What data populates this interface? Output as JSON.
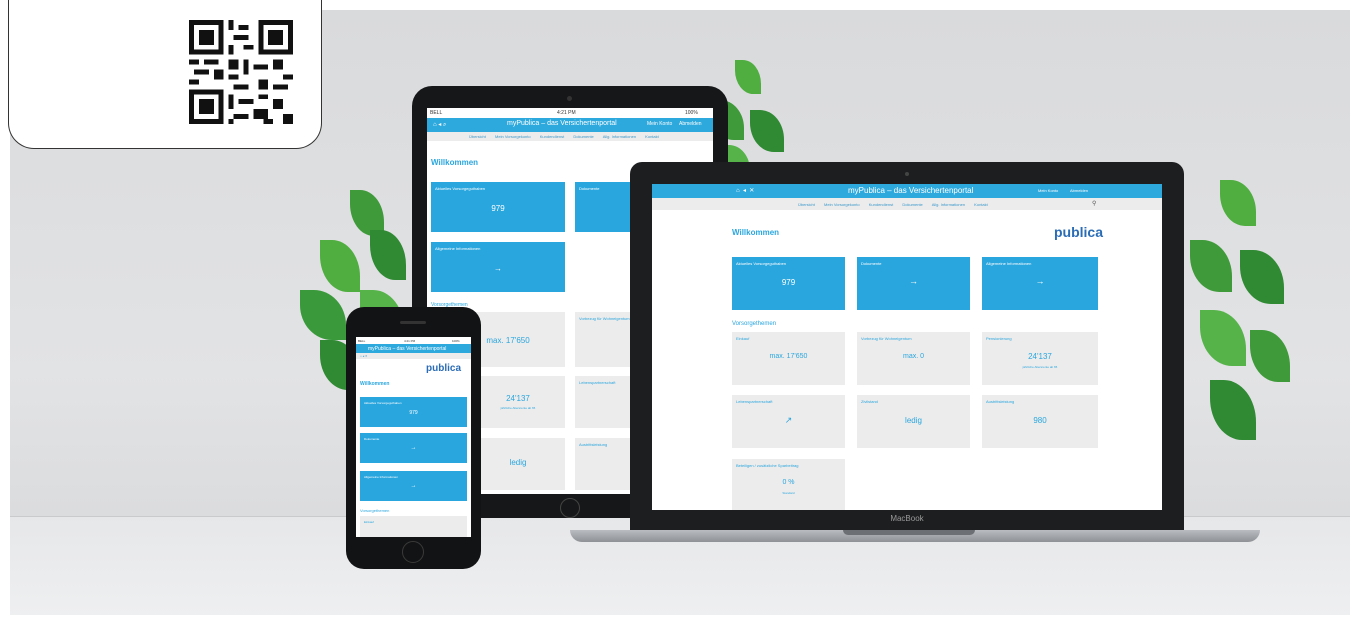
{
  "app": {
    "title": "myPublica – das Versichertenportal",
    "title_short": "myPublica – das Versichertenportal",
    "logo": "publica",
    "header_right": [
      "Mein Konto",
      "Abmelden"
    ],
    "nav": [
      "Übersicht",
      "Mein Vorsorgekonto",
      "Kundendienst",
      "Dokumente",
      "Allg. Informationen",
      "Kontakt"
    ]
  },
  "page": {
    "heading": "Willkommen",
    "section_heading": "Vorsorgethemen"
  },
  "blue_tiles": [
    {
      "label": "Aktuelles Vorsorgeguthaben",
      "value": "979"
    },
    {
      "label": "Dokumente",
      "value": "→"
    },
    {
      "label": "Allgemeine Informationen",
      "value": "→"
    }
  ],
  "grey_tiles": [
    {
      "label": "Einkauf",
      "value": "max. 17'650",
      "sub": ""
    },
    {
      "label": "Vorbezug für Wohneigentum",
      "value": "max. 0",
      "sub": ""
    },
    {
      "label": "Pensionierung",
      "value": "24'137",
      "sub": "jährliche Altersrente ab 65"
    },
    {
      "label": "Lebenspartnerschaft",
      "value": "↗",
      "sub": ""
    },
    {
      "label": "Zivilstand",
      "value": "ledig",
      "sub": ""
    },
    {
      "label": "Austrittsleistung",
      "value": "980",
      "sub": ""
    },
    {
      "label": "Beteiligen / zusätzliche Sparbeitrag",
      "value": "0 %",
      "sub": "Standard"
    }
  ],
  "tablet_status": {
    "carrier": "BELL",
    "time": "4:21 PM",
    "battery": "100%"
  },
  "phone_status": {
    "carrier": "BELL",
    "time": "4:21 PM",
    "battery": "100%"
  },
  "phone_footer_link": "Einkauf",
  "device_brand": "MacBook",
  "colors": {
    "accent": "#2aa6de",
    "brand": "#2a6cb5",
    "tile_grey": "#ececec"
  }
}
